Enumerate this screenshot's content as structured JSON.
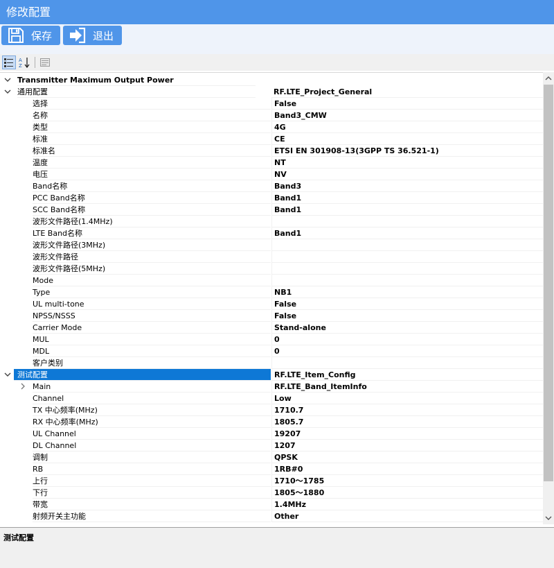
{
  "window": {
    "title": "修改配置"
  },
  "toolbar": {
    "save_label": "保存",
    "exit_label": "退出"
  },
  "grid": {
    "rows": [
      {
        "kind": "head",
        "name": "Transmitter Maximum Output Power",
        "value": ""
      },
      {
        "kind": "cat",
        "name": "通用配置",
        "value": "RF.LTE_Project_General"
      },
      {
        "kind": "prop",
        "name": "选择",
        "value": "False"
      },
      {
        "kind": "prop",
        "name": "名称",
        "value": "Band3_CMW"
      },
      {
        "kind": "prop",
        "name": "类型",
        "value": "4G"
      },
      {
        "kind": "prop",
        "name": "标准",
        "value": "CE"
      },
      {
        "kind": "prop",
        "name": "标准名",
        "value": "ETSI EN 301908-13(3GPP TS 36.521-1)"
      },
      {
        "kind": "prop",
        "name": "温度",
        "value": "NT"
      },
      {
        "kind": "prop",
        "name": "电压",
        "value": "NV"
      },
      {
        "kind": "prop",
        "name": "Band名称",
        "value": "Band3"
      },
      {
        "kind": "prop",
        "name": "PCC Band名称",
        "value": "Band1"
      },
      {
        "kind": "prop",
        "name": "SCC Band名称",
        "value": "Band1"
      },
      {
        "kind": "prop",
        "name": "波形文件路径(1.4MHz)",
        "value": ""
      },
      {
        "kind": "prop",
        "name": "LTE Band名称",
        "value": "Band1"
      },
      {
        "kind": "prop",
        "name": "波形文件路径(3MHz)",
        "value": ""
      },
      {
        "kind": "prop",
        "name": "波形文件路径",
        "value": ""
      },
      {
        "kind": "prop",
        "name": "波形文件路径(5MHz)",
        "value": ""
      },
      {
        "kind": "prop",
        "name": "Mode",
        "value": ""
      },
      {
        "kind": "prop",
        "name": "Type",
        "value": "NB1"
      },
      {
        "kind": "prop",
        "name": "UL multi-tone",
        "value": "False"
      },
      {
        "kind": "prop",
        "name": "NPSS/NSSS",
        "value": "False"
      },
      {
        "kind": "prop",
        "name": "Carrier Mode",
        "value": "Stand-alone"
      },
      {
        "kind": "prop",
        "name": "MUL",
        "value": "0"
      },
      {
        "kind": "prop",
        "name": "MDL",
        "value": "0"
      },
      {
        "kind": "prop",
        "name": "客户类别",
        "value": ""
      },
      {
        "kind": "sel",
        "name": "测试配置",
        "value": "RF.LTE_Item_Config"
      },
      {
        "kind": "sub",
        "name": "Main",
        "value": "RF.LTE_Band_ItemInfo"
      },
      {
        "kind": "prop",
        "name": "Channel",
        "value": "Low"
      },
      {
        "kind": "prop",
        "name": "TX 中心频率(MHz)",
        "value": "1710.7"
      },
      {
        "kind": "prop",
        "name": "RX 中心频率(MHz)",
        "value": "1805.7"
      },
      {
        "kind": "prop",
        "name": "UL Channel",
        "value": "19207"
      },
      {
        "kind": "prop",
        "name": "DL Channel",
        "value": "1207"
      },
      {
        "kind": "prop",
        "name": "调制",
        "value": "QPSK"
      },
      {
        "kind": "prop",
        "name": "RB",
        "value": "1RB#0"
      },
      {
        "kind": "prop",
        "name": "上行",
        "value": "1710～1785"
      },
      {
        "kind": "prop",
        "name": "下行",
        "value": "1805～1880"
      },
      {
        "kind": "prop",
        "name": "带宽",
        "value": "1.4MHz"
      },
      {
        "kind": "prop",
        "name": "射频开关主功能",
        "value": "Other"
      }
    ]
  },
  "description": {
    "title": "测试配置"
  },
  "colors": {
    "accent": "#4f95e9",
    "selection": "#0e78d6"
  }
}
